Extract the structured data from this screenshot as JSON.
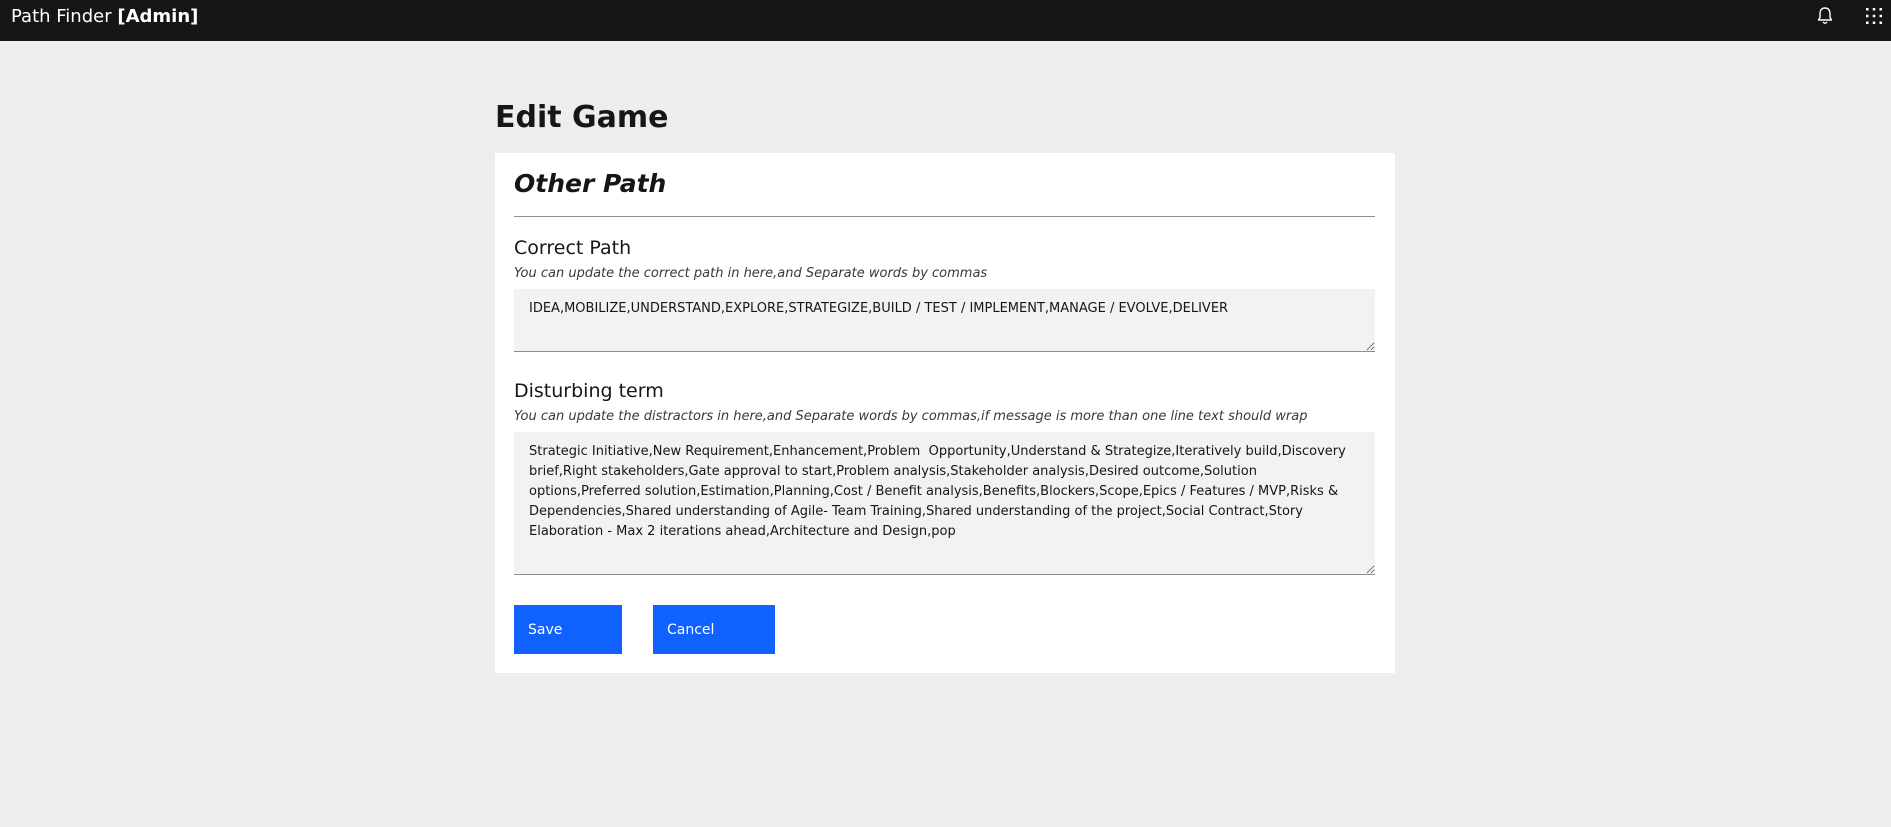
{
  "header": {
    "app_name": "Path Finder",
    "role_badge": "[Admin]",
    "icons": [
      "notification-icon",
      "app-switcher-icon"
    ]
  },
  "page": {
    "title": "Edit Game"
  },
  "form": {
    "section_title": "Other Path",
    "correct_path": {
      "label": "Correct Path",
      "help": "You can update the correct path in here,and Separate words by commas",
      "value": "IDEA,MOBILIZE,UNDERSTAND,EXPLORE,STRATEGIZE,BUILD / TEST / IMPLEMENT,MANAGE / EVOLVE,DELIVER"
    },
    "disturbing_term": {
      "label": "Disturbing term",
      "help": "You can update the distractors in here,and Separate words by commas,if message is more than one line text should wrap",
      "value": "Strategic Initiative,New Requirement,Enhancement,Problem  Opportunity,Understand & Strategize,Iteratively build,Discovery brief,Right stakeholders,Gate approval to start,Problem analysis,Stakeholder analysis,Desired outcome,Solution options,Preferred solution,Estimation,Planning,Cost / Benefit analysis,Benefits,Blockers,Scope,Epics / Features / MVP,Risks & Dependencies,Shared understanding of Agile- Team Training,Shared understanding of the project,Social Contract,Story Elaboration - Max 2 iterations ahead,Architecture and Design,pop"
    },
    "buttons": {
      "save": "Save",
      "cancel": "Cancel"
    }
  },
  "colors": {
    "header_bg": "#161616",
    "page_bg": "#ededed",
    "primary_button": "#0f62fe"
  }
}
